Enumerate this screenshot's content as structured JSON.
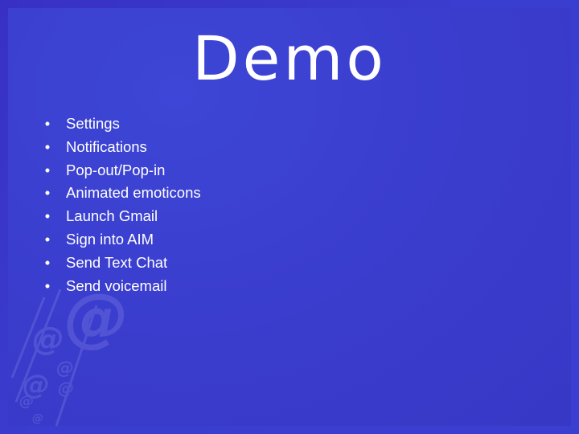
{
  "slide": {
    "title": "Demo",
    "bullet_glyph": "•",
    "bullets": [
      {
        "label": "Settings"
      },
      {
        "label": "Notifications"
      },
      {
        "label": "Pop-out/Pop-in"
      },
      {
        "label": "Animated emoticons"
      },
      {
        "label": "Launch Gmail"
      },
      {
        "label": "Sign into AIM"
      },
      {
        "label": "Send Text Chat"
      },
      {
        "label": "Send voicemail"
      }
    ],
    "watermark_glyph": "@",
    "colors": {
      "background": "#3a3ccc",
      "text": "#ffffff"
    }
  }
}
